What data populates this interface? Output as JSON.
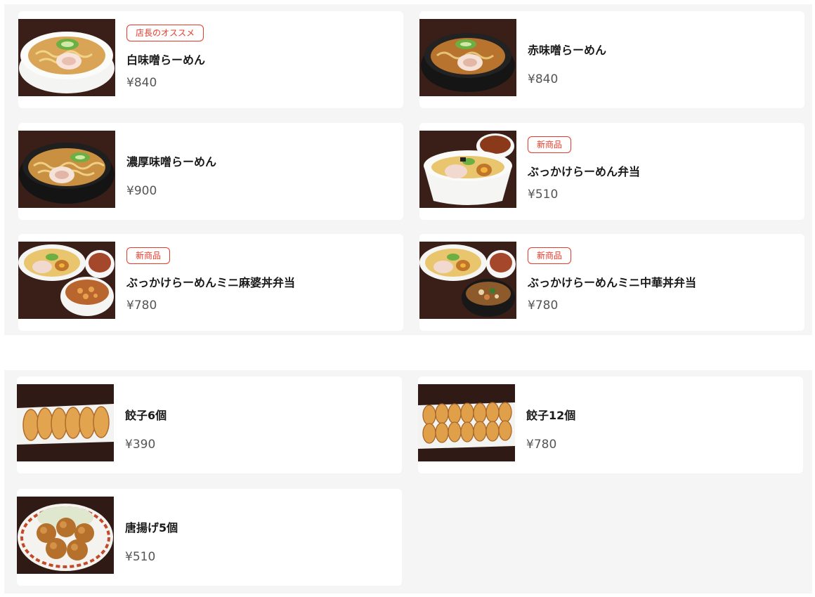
{
  "sections": [
    {
      "items": [
        {
          "name": "白味噌らーめん",
          "price": "¥840",
          "badge": "店長のオススメ",
          "image": "white-miso-ramen-photo"
        },
        {
          "name": "赤味噌らーめん",
          "price": "¥840",
          "badge": "",
          "image": "red-miso-ramen-photo"
        },
        {
          "name": "濃厚味噌らーめん",
          "price": "¥900",
          "badge": "",
          "image": "rich-miso-ramen-photo"
        },
        {
          "name": "ぶっかけらーめん弁当",
          "price": "¥510",
          "badge": "新商品",
          "image": "bukkake-ramen-bento-photo"
        },
        {
          "name": "ぶっかけらーめんミニ麻婆丼弁当",
          "price": "¥780",
          "badge": "新商品",
          "image": "bukkake-ramen-mapo-don-bento-photo"
        },
        {
          "name": "ぶっかけらーめんミニ中華丼弁当",
          "price": "¥780",
          "badge": "新商品",
          "image": "bukkake-ramen-chuka-don-bento-photo"
        }
      ]
    },
    {
      "items": [
        {
          "name": "餃子6個",
          "price": "¥390",
          "badge": "",
          "image": "gyoza-6-photo"
        },
        {
          "name": "餃子12個",
          "price": "¥780",
          "badge": "",
          "image": "gyoza-12-photo"
        },
        {
          "name": "唐揚げ5個",
          "price": "¥510",
          "badge": "",
          "image": "karaage-5-photo"
        }
      ]
    }
  ],
  "colors": {
    "badge": "#e8392a",
    "section_bg": "#f5f5f5",
    "card_bg": "#ffffff",
    "price": "#555555"
  }
}
